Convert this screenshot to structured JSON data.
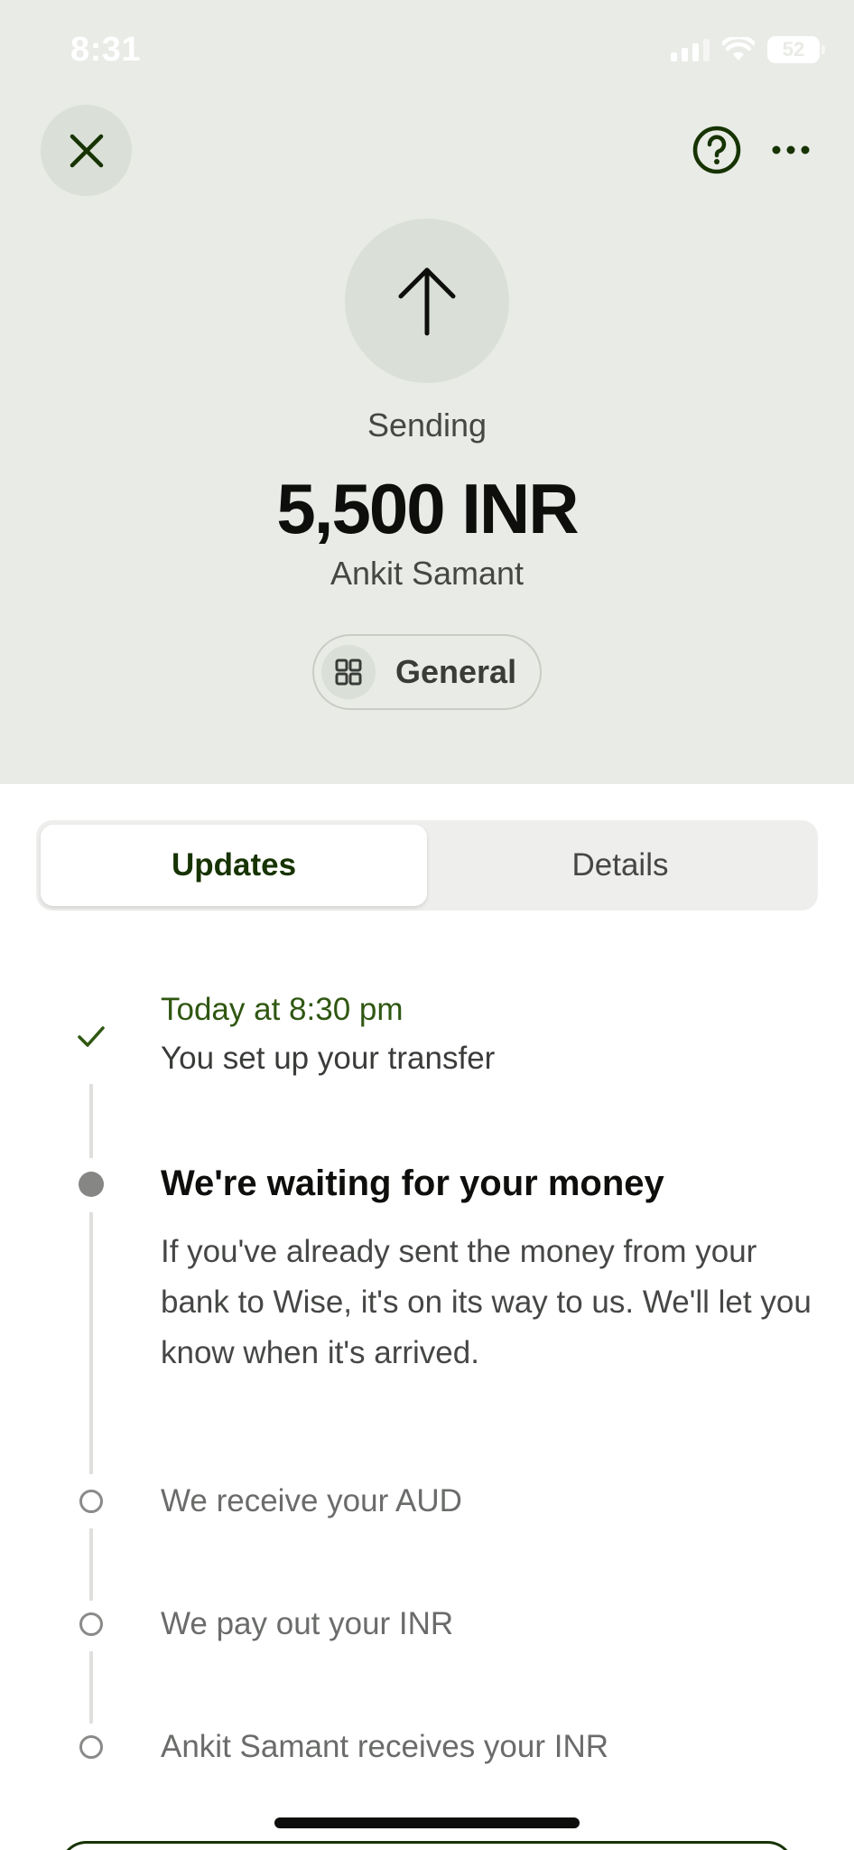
{
  "status_bar": {
    "time": "8:31",
    "battery": "52"
  },
  "header": {
    "icons": {
      "close": "close-x-icon",
      "help": "question-circle-icon",
      "more": "more-dots-icon",
      "send": "arrow-up-icon"
    },
    "status_label": "Sending",
    "amount": "5,500 INR",
    "recipient": "Ankit Samant",
    "category": {
      "label": "General",
      "icon": "grid-icon"
    }
  },
  "tabs": [
    {
      "label": "Updates",
      "active": true
    },
    {
      "label": "Details",
      "active": false
    }
  ],
  "timeline": {
    "completed": {
      "time": "Today at 8:30 pm",
      "text": "You set up your transfer",
      "icon": "check-icon"
    },
    "current": {
      "heading": "We're waiting for your money",
      "body": "If you've already sent the money from your bank to Wise, it's on its way to us. We'll let you know when it's arrived."
    },
    "pending": [
      {
        "text": "We receive your AUD"
      },
      {
        "text": "We pay out your INR"
      },
      {
        "text": "Ankit Samant receives your INR"
      }
    ]
  },
  "colors": {
    "header_bg": "#e9ebe6",
    "accent_green": "#163300",
    "time_green": "#2f5711"
  }
}
